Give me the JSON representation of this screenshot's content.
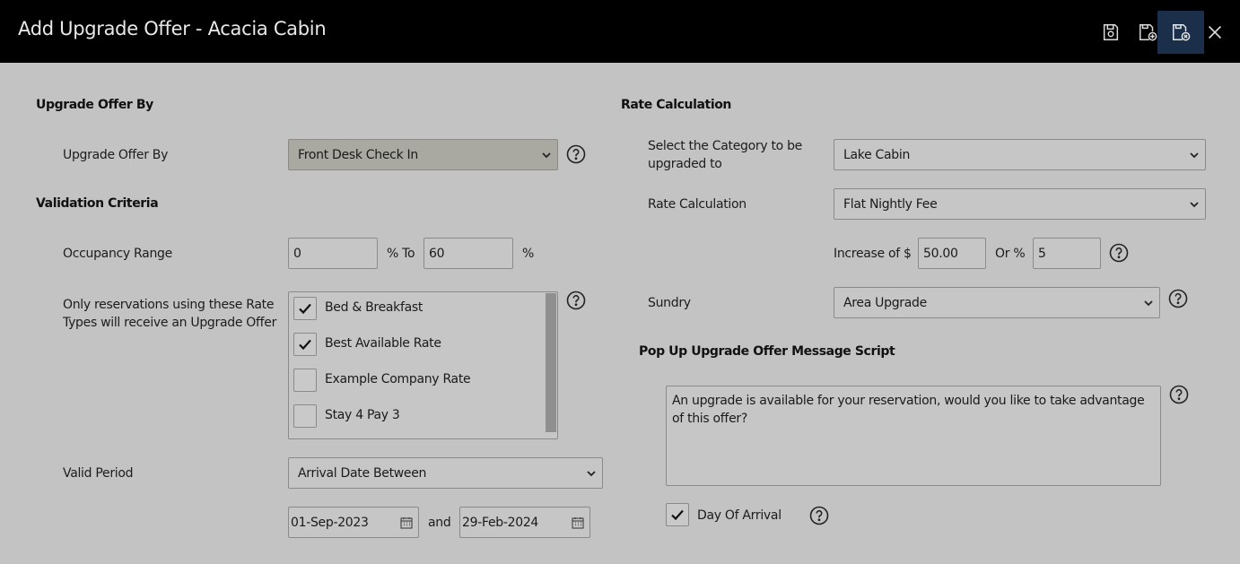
{
  "window": {
    "title": "Add Upgrade Offer - Acacia Cabin"
  },
  "toolbar": {
    "save_icon": "save-icon",
    "save_new_icon": "save-and-new-icon",
    "save_close_icon": "save-and-close-icon",
    "close_icon": "close-icon"
  },
  "left": {
    "upgrade_offer_by_heading": "Upgrade Offer By",
    "upgrade_offer_by_label": "Upgrade Offer By",
    "upgrade_offer_by_value": "Front Desk Check In",
    "validation_heading": "Validation Criteria",
    "occupancy_label": "Occupancy Range",
    "occupancy_from": "0",
    "occupancy_to_label": "% To",
    "occupancy_to": "60",
    "occupancy_pct": "%",
    "rate_types_label_line1": "Only reservations using these Rate",
    "rate_types_label_line2": "Types will receive an Upgrade Offer",
    "rate_types": [
      {
        "label": "Bed & Breakfast",
        "checked": true
      },
      {
        "label": "Best Available Rate",
        "checked": true
      },
      {
        "label": "Example Company Rate",
        "checked": false
      },
      {
        "label": "Stay 4 Pay 3",
        "checked": false
      }
    ],
    "valid_period_label": "Valid Period",
    "valid_period_value": "Arrival Date Between",
    "date_from": "01-Sep-2023",
    "date_and": "and",
    "date_to": "29-Feb-2024"
  },
  "right": {
    "rate_calc_heading": "Rate Calculation",
    "category_label_line1": "Select the Category to be",
    "category_label_line2": "upgraded to",
    "category_value": "Lake Cabin",
    "rate_calc_label": "Rate Calculation",
    "rate_calc_value": "Flat Nightly Fee",
    "increase_label": "Increase of $",
    "increase_value": "50.00",
    "or_pct_label": "Or %",
    "or_pct_value": "5",
    "sundry_label": "Sundry",
    "sundry_value": "Area Upgrade",
    "popup_heading": "Pop Up Upgrade Offer Message Script",
    "popup_message": "An upgrade is available for your reservation, would you like to take advantage of this offer?",
    "day_of_arrival_label": "Day Of Arrival",
    "day_of_arrival_checked": true
  },
  "colors": {
    "header_bg": "#000000",
    "page_bg": "#c3c3c3",
    "active_button_bg": "#1b2f4a"
  }
}
